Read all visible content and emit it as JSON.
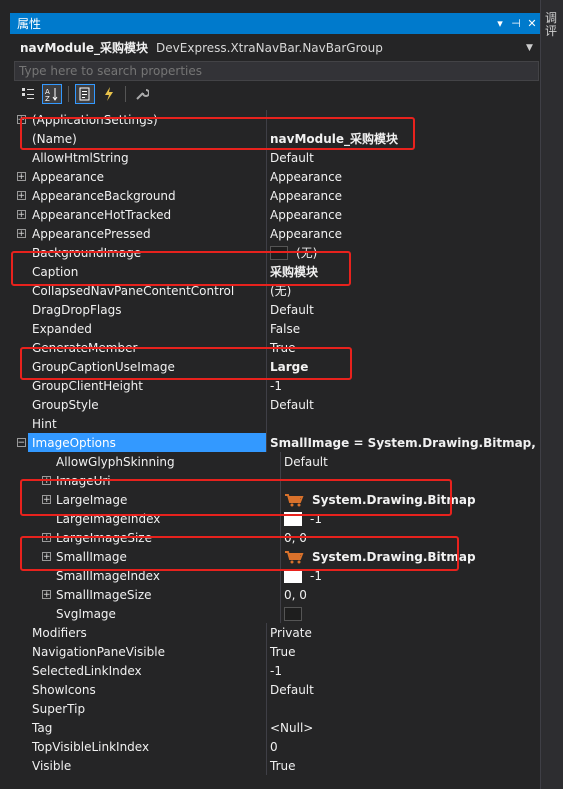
{
  "window": {
    "title": "属性",
    "side_label": "调 评"
  },
  "object_selector": {
    "name": "navModule_采购模块",
    "type": "DevExpress.XtraNavBar.NavBarGroup"
  },
  "search": {
    "placeholder": "Type here to search properties"
  },
  "toolbar": [
    "categorized-icon",
    "alphabetical-icon",
    "properties-icon",
    "events-icon",
    "property-pages-icon"
  ],
  "rows": [
    {
      "name": "(ApplicationSettings)",
      "value": "",
      "expandable": true
    },
    {
      "name": "(Name)",
      "value": "navModule_采购模块",
      "bold": true
    },
    {
      "name": "AllowHtmlString",
      "value": "Default"
    },
    {
      "name": "Appearance",
      "value": "Appearance",
      "expandable": true
    },
    {
      "name": "AppearanceBackground",
      "value": "Appearance",
      "expandable": true
    },
    {
      "name": "AppearanceHotTracked",
      "value": "Appearance",
      "expandable": true
    },
    {
      "name": "AppearancePressed",
      "value": "Appearance",
      "expandable": true
    },
    {
      "name": "BackgroundImage",
      "value": "(无)",
      "swatch": "dark"
    },
    {
      "name": "Caption",
      "value": "采购模块",
      "bold": true
    },
    {
      "name": "CollapsedNavPaneContentControl",
      "value": "(无)"
    },
    {
      "name": "DragDropFlags",
      "value": "Default"
    },
    {
      "name": "Expanded",
      "value": "False"
    },
    {
      "name": "GenerateMember",
      "value": "True"
    },
    {
      "name": "GroupCaptionUseImage",
      "value": "Large",
      "bold": true
    },
    {
      "name": "GroupClientHeight",
      "value": "-1"
    },
    {
      "name": "GroupStyle",
      "value": "Default"
    },
    {
      "name": "Hint",
      "value": ""
    },
    {
      "name": "ImageOptions",
      "value": "SmallImage = System.Drawing.Bitmap, Larg",
      "bold": true,
      "expanded": true,
      "selected": true
    },
    {
      "name": "AllowGlyphSkinning",
      "value": "Default",
      "child": true
    },
    {
      "name": "ImageUri",
      "value": "",
      "child": true,
      "expandable": true
    },
    {
      "name": "LargeImage",
      "value": "System.Drawing.Bitmap",
      "bold": true,
      "child": true,
      "expandable": true,
      "cart": true
    },
    {
      "name": "LargeImageIndex",
      "value": "-1",
      "child": true,
      "swatch": "white"
    },
    {
      "name": "LargeImageSize",
      "value": "0, 0",
      "child": true,
      "expandable": true
    },
    {
      "name": "SmallImage",
      "value": "System.Drawing.Bitmap",
      "bold": true,
      "child": true,
      "expandable": true,
      "cart": true
    },
    {
      "name": "SmallImageIndex",
      "value": "-1",
      "child": true,
      "swatch": "white"
    },
    {
      "name": "SmallImageSize",
      "value": "0, 0",
      "child": true,
      "expandable": true
    },
    {
      "name": "SvgImage",
      "value": "",
      "child": true,
      "swatch": "dark"
    },
    {
      "name": "Modifiers",
      "value": "Private"
    },
    {
      "name": "NavigationPaneVisible",
      "value": "True"
    },
    {
      "name": "SelectedLinkIndex",
      "value": "-1"
    },
    {
      "name": "ShowIcons",
      "value": "Default"
    },
    {
      "name": "SuperTip",
      "value": ""
    },
    {
      "name": "Tag",
      "value": "<Null>"
    },
    {
      "name": "TopVisibleLinkIndex",
      "value": "0"
    },
    {
      "name": "Visible",
      "value": "True"
    }
  ],
  "colors": {
    "accent": "#007acc",
    "selection": "#3399ff",
    "highlight_box": "#e8221d",
    "background": "#252526"
  }
}
